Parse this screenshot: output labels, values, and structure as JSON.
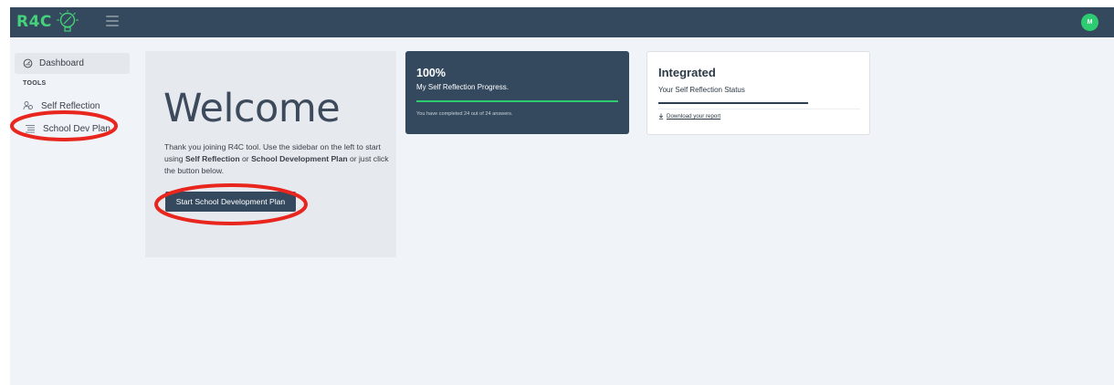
{
  "topbar": {
    "logo_text": "R4C",
    "avatar_initial": "M"
  },
  "sidebar": {
    "dashboard_label": "Dashboard",
    "tools_heading": "TOOLS",
    "items": [
      {
        "label": "Self Reflection"
      },
      {
        "label": "School Dev Plan"
      }
    ]
  },
  "welcome": {
    "heading": "Welcome",
    "text_1": "Thank you joining R4C tool. Use the sidebar on the left to start using ",
    "link_self": "Self Reflection",
    "text_2": " or ",
    "link_sdp": "School Development Plan",
    "text_3": " or just click the button below.",
    "button_label": "Start School Development Plan"
  },
  "progress_card": {
    "percent": "100%",
    "subtitle": "My Self Reflection Progress.",
    "progress_fraction": 1.0,
    "note": "You have completed 24 out of 24 answers."
  },
  "status_card": {
    "title": "Integrated",
    "subtitle": "Your Self Reflection Status",
    "download_label": "Download your report"
  },
  "colors": {
    "topbar": "#34495e",
    "accent_green": "#2ecc71",
    "page_bg": "#f0f3f7",
    "annotation_red": "#e8261e"
  }
}
